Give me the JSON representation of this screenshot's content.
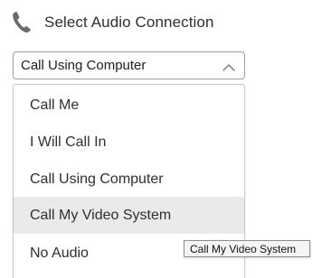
{
  "header": {
    "icon": "phone-icon",
    "title": "Select Audio Connection"
  },
  "select": {
    "value": "Call Using Computer",
    "icon": "chevron-up-icon",
    "expanded": true
  },
  "options": [
    {
      "label": "Call Me"
    },
    {
      "label": "I Will Call In"
    },
    {
      "label": "Call Using Computer"
    },
    {
      "label": "Call My Video System",
      "highlighted": true
    },
    {
      "label": "No Audio"
    }
  ],
  "tooltip": {
    "text": "Call My Video System"
  },
  "colors": {
    "phone_icon": "#6b6b6b",
    "highlight_bg": "#eaeaea",
    "border": "#9e9e9e"
  }
}
